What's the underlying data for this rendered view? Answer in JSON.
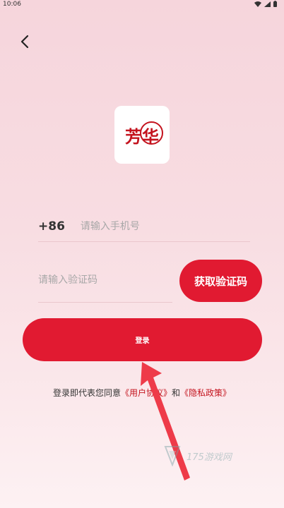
{
  "status_bar": {
    "time": "10:06"
  },
  "logo": {
    "text_fang": "芳",
    "text_hua": "华"
  },
  "phone": {
    "country_code": "+86",
    "placeholder": "请输入手机号",
    "value": ""
  },
  "code": {
    "placeholder": "请输入验证码",
    "value": ""
  },
  "get_code_label": "获取验证码",
  "login_label": "登录",
  "agreement": {
    "prefix": "登录即代表您同意",
    "user_agreement": "《用户协议》",
    "and": "和",
    "privacy_policy": "《隐私政策》"
  },
  "watermark": {
    "text": "175游戏网"
  },
  "colors": {
    "accent": "#e11a31",
    "logo_red": "#c4131e",
    "annotation_arrow": "#ee3b49"
  }
}
